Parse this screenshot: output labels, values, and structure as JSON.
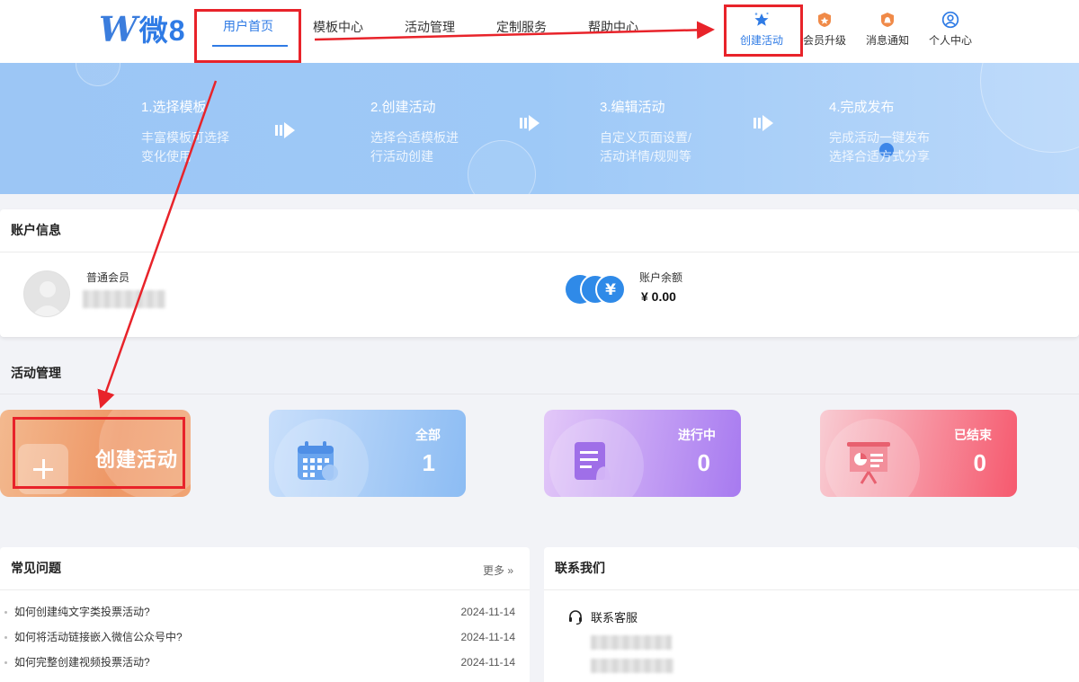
{
  "header": {
    "logo_text": "微8",
    "nav": [
      {
        "label": "用户首页",
        "active": true
      },
      {
        "label": "模板中心"
      },
      {
        "label": "活动管理"
      },
      {
        "label": "定制服务"
      },
      {
        "label": "帮助中心"
      }
    ],
    "actions": [
      {
        "label": "创建活动",
        "icon": "star-icon"
      },
      {
        "label": "会员升级",
        "icon": "vip-badge-icon"
      },
      {
        "label": "消息通知",
        "icon": "bell-badge-icon"
      },
      {
        "label": "个人中心",
        "icon": "user-circle-icon"
      }
    ]
  },
  "banner": {
    "steps": [
      {
        "title": "1.选择模板",
        "desc": "丰富模板可选择变化使用"
      },
      {
        "title": "2.创建活动",
        "desc": "选择合适模板进行活动创建"
      },
      {
        "title": "3.编辑活动",
        "desc": "自定义页面设置/活动详情/规则等"
      },
      {
        "title": "4.完成发布",
        "desc": "完成活动一键发布选择合适方式分享"
      }
    ]
  },
  "account": {
    "title": "账户信息",
    "member_level": "普通会员",
    "balance_label": "账户余额",
    "balance_value": "¥ 0.00"
  },
  "activity": {
    "title": "活动管理",
    "create_label": "创建活动",
    "cards": [
      {
        "label": "全部",
        "count": "1"
      },
      {
        "label": "进行中",
        "count": "0"
      },
      {
        "label": "已结束",
        "count": "0"
      }
    ]
  },
  "faq": {
    "title": "常见问题",
    "more": "更多 »",
    "items": [
      {
        "q": "如何创建纯文字类投票活动?",
        "date": "2024-11-14"
      },
      {
        "q": "如何将活动链接嵌入微信公众号中?",
        "date": "2024-11-14"
      },
      {
        "q": "如何完整创建视频投票活动?",
        "date": "2024-11-14"
      }
    ]
  },
  "contact": {
    "title": "联系我们",
    "service_label": "联系客服"
  },
  "colors": {
    "accent": "#2f7be5",
    "annotation": "#e8232a"
  }
}
